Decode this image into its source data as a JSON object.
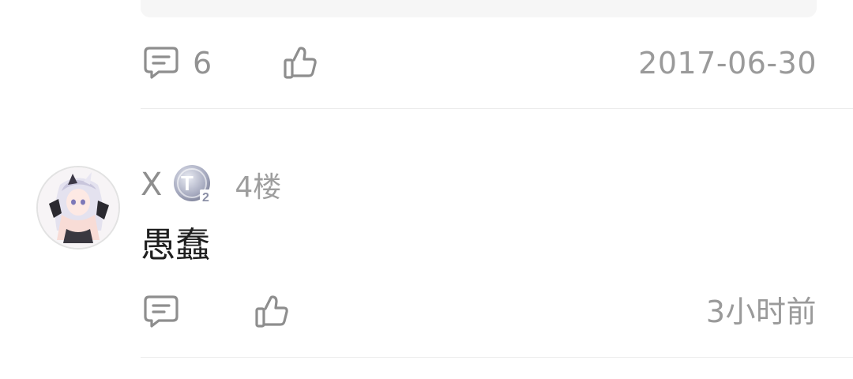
{
  "previous_post": {
    "reply_count": "6",
    "date": "2017-06-30",
    "reply_icon": "comment-icon",
    "like_icon": "thumbs-up-icon"
  },
  "reply": {
    "username": "X",
    "level_badge": "T2",
    "floor": "4楼",
    "content": "愚蠢",
    "time": "3小时前",
    "reply_icon": "comment-icon",
    "like_icon": "thumbs-up-icon"
  }
}
